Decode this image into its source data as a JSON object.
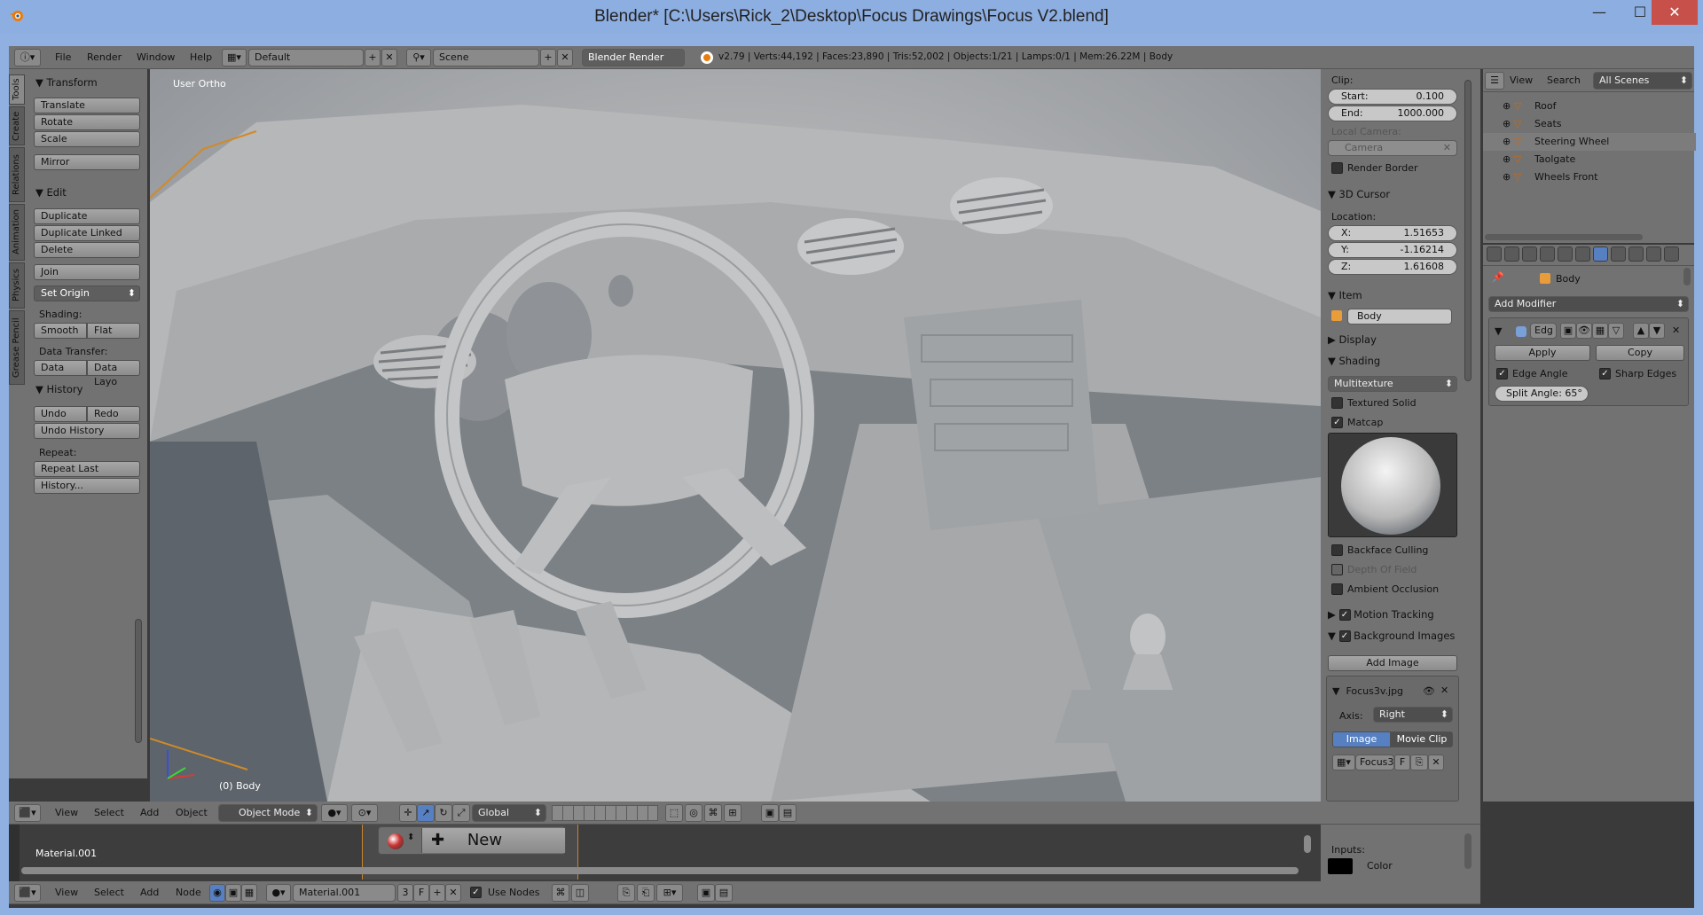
{
  "window": {
    "title": "Blender* [C:\\Users\\Rick_2\\Desktop\\Focus Drawings\\Focus V2.blend]",
    "minimize": "—",
    "maximize": "☐",
    "close": "✕"
  },
  "info_header": {
    "menus": [
      "File",
      "Render",
      "Window",
      "Help"
    ],
    "layout": "Default",
    "scene": "Scene",
    "engine": "Blender Render",
    "stats": "v2.79 | Verts:44,192 | Faces:23,890 | Tris:52,002 | Objects:1/21 | Lamps:0/1 | Mem:26.22M | Body"
  },
  "toolshelf": {
    "tabs": [
      "Tools",
      "Create",
      "Relations",
      "Animation",
      "Physics",
      "Grease Pencil"
    ],
    "transform": {
      "title": "Transform",
      "buttons": [
        "Translate",
        "Rotate",
        "Scale",
        "Mirror"
      ]
    },
    "edit": {
      "title": "Edit",
      "buttons": [
        "Duplicate",
        "Duplicate Linked",
        "Delete",
        "Join"
      ],
      "set_origin": "Set Origin",
      "shading_label": "Shading:",
      "smooth": "Smooth",
      "flat": "Flat",
      "data_transfer_label": "Data Transfer:",
      "data": "Data",
      "data_layout": "Data Layo"
    },
    "history": {
      "title": "History",
      "undo": "Undo",
      "redo": "Redo",
      "undo_history": "Undo History",
      "repeat_label": "Repeat:",
      "repeat_last": "Repeat Last",
      "history_btn": "History..."
    }
  },
  "viewport": {
    "view_name": "User Ortho",
    "object_label": "(0) Body"
  },
  "view3d_header": {
    "menus": [
      "View",
      "Select",
      "Add",
      "Object"
    ],
    "mode": "Object Mode",
    "orientation": "Global"
  },
  "properties_panel": {
    "clip_label": "Clip:",
    "start": {
      "label": "Start:",
      "value": "0.100"
    },
    "end": {
      "label": "End:",
      "value": "1000.000"
    },
    "local_camera_label": "Local Camera:",
    "camera_field": "Camera",
    "render_border": "Render Border",
    "cursor_title": "3D Cursor",
    "location_label": "Location:",
    "x": {
      "label": "X:",
      "value": "1.51653"
    },
    "y": {
      "label": "Y:",
      "value": "-1.16214"
    },
    "z": {
      "label": "Z:",
      "value": "1.61608"
    },
    "item_title": "Item",
    "item_name": "Body",
    "display_title": "Display",
    "shading_title": "Shading",
    "shading_mode": "Multitexture",
    "textured_solid": "Textured Solid",
    "matcap": "Matcap",
    "backface_culling": "Backface Culling",
    "depth_of_field": "Depth Of Field",
    "ambient_occlusion": "Ambient Occlusion",
    "motion_tracking": "Motion Tracking",
    "background_images": "Background Images",
    "add_image": "Add Image",
    "bg_image_name": "Focus3v.jpg",
    "axis_label": "Axis:",
    "axis_value": "Right",
    "image_tab": "Image",
    "movie_clip_tab": "Movie Clip",
    "image_block": "Focus3",
    "image_block_flag": "F"
  },
  "outliner": {
    "menus": [
      "View",
      "Search"
    ],
    "filter": "All Scenes",
    "items": [
      "Roof",
      "Seats",
      "Steering Wheel",
      "Taolgate",
      "Wheels Front"
    ]
  },
  "modifier_panel": {
    "object_name": "Body",
    "add_modifier": "Add Modifier",
    "modifier_name": "Edg",
    "apply": "Apply",
    "copy": "Copy",
    "edge_angle": "Edge Angle",
    "sharp_edges": "Sharp Edges",
    "split_angle": "Split Angle: 65°"
  },
  "node_editor": {
    "material_name": "Material.001",
    "new_button": "New",
    "inputs_label": "Inputs:",
    "color_label": "Color",
    "menus": [
      "View",
      "Select",
      "Add",
      "Node"
    ],
    "material_field": "Material.001",
    "users": "3",
    "fake_user": "F",
    "use_nodes": "Use Nodes"
  },
  "colors": {
    "accent_blue": "#5680c2",
    "panel_grey": "#727272",
    "viewport_grey": "#8d9196"
  }
}
